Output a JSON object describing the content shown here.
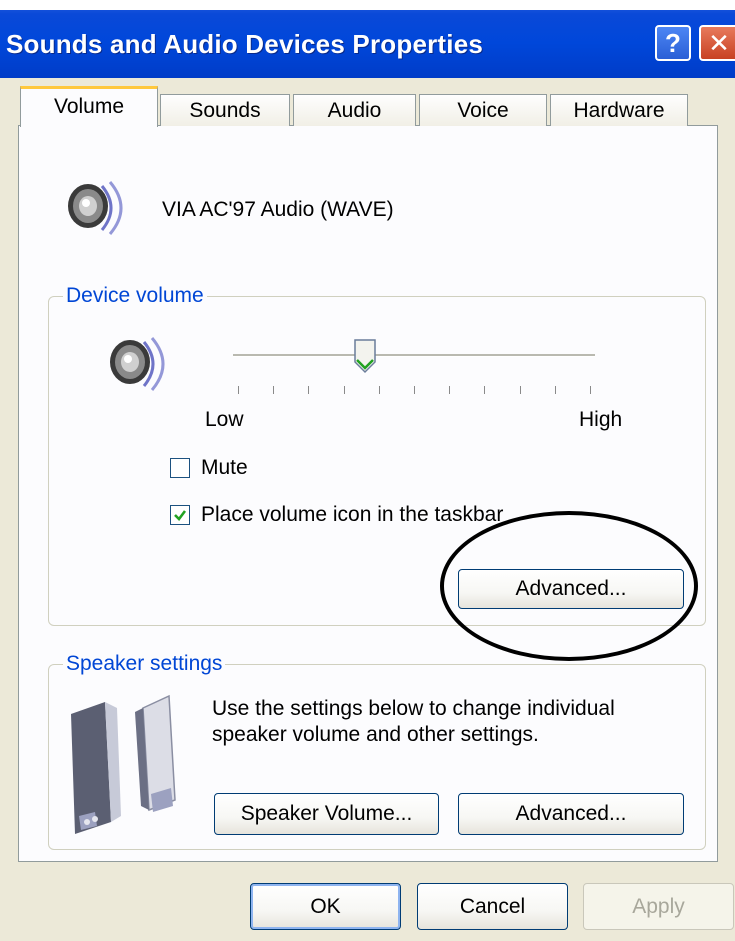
{
  "window": {
    "title": "Sounds and Audio Devices Properties",
    "help_label": "?",
    "close_label": "✕"
  },
  "tabs": [
    {
      "label": "Volume",
      "active": true
    },
    {
      "label": "Sounds",
      "active": false
    },
    {
      "label": "Audio",
      "active": false
    },
    {
      "label": "Voice",
      "active": false
    },
    {
      "label": "Hardware",
      "active": false
    }
  ],
  "device": {
    "name": "VIA AC'97 Audio (WAVE)",
    "icon": "speaker-icon"
  },
  "device_volume": {
    "legend": "Device volume",
    "slider": {
      "level_fraction": 0.36,
      "low_label": "Low",
      "high_label": "High",
      "tick_count": 11
    },
    "mute": {
      "label": "Mute",
      "checked": false
    },
    "taskbar_icon": {
      "label": "Place volume icon in the taskbar",
      "checked": true
    },
    "advanced_label": "Advanced..."
  },
  "speaker_settings": {
    "legend": "Speaker settings",
    "description_line1": "Use the settings below to change individual",
    "description_line2": "speaker volume and other settings.",
    "speaker_volume_label": "Speaker Volume...",
    "advanced_label": "Advanced..."
  },
  "footer": {
    "ok_label": "OK",
    "cancel_label": "Cancel",
    "apply_label": "Apply"
  },
  "colors": {
    "title_bar": "#0047da",
    "group_legend": "#0046d5",
    "active_tab_highlight": "#ffc83c",
    "dialog_bg": "#ece9d8"
  }
}
